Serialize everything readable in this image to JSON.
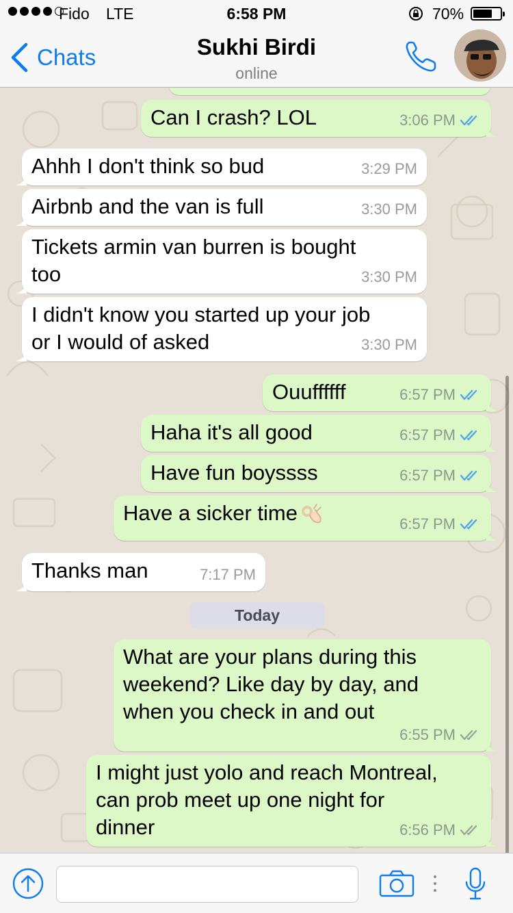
{
  "status_bar": {
    "carrier": "Fido",
    "network": "LTE",
    "time": "6:58 PM",
    "battery_percent": "70%",
    "battery_level": 0.7
  },
  "header": {
    "back_label": "Chats",
    "contact_name": "Sukhi Birdi",
    "status": "online"
  },
  "messages": [
    {
      "dir": "out",
      "text": "Can I crash? LOL",
      "time": "3:06 PM",
      "read": true
    },
    {
      "dir": "in",
      "text": "Ahhh I don't think so bud",
      "time": "3:29 PM"
    },
    {
      "dir": "in",
      "text": "Airbnb and the van is full",
      "time": "3:30 PM"
    },
    {
      "dir": "in",
      "text": "Tickets armin van burren is bought\ntoo",
      "time": "3:30 PM"
    },
    {
      "dir": "in",
      "text": "I didn't know you started up your job\nor I would of asked",
      "time": "3:30 PM"
    },
    {
      "dir": "out",
      "text": "Ouuffffff",
      "time": "6:57 PM",
      "read": true
    },
    {
      "dir": "out",
      "text": "Haha it's all good",
      "time": "6:57 PM",
      "read": true
    },
    {
      "dir": "out",
      "text": "Have fun boyssss",
      "time": "6:57 PM",
      "read": true
    },
    {
      "dir": "out",
      "text": "Have a sicker time",
      "time": "6:57 PM",
      "read": true,
      "emoji": "ok-hand-emoji"
    },
    {
      "dir": "in",
      "text": "Thanks man",
      "time": "7:17 PM"
    },
    {
      "dir": "out",
      "text": "What are your plans during this\nweekend? Like day by day, and\nwhen you check in and out",
      "time": "6:55 PM",
      "read": false
    },
    {
      "dir": "out",
      "text": "I might just yolo and reach Montreal,\ncan prob meet up one night for\ndinner",
      "time": "6:56 PM",
      "read": false
    }
  ],
  "day_separator": "Today",
  "input": {
    "placeholder": "",
    "value": ""
  },
  "colors": {
    "accent": "#0d7cf1",
    "outgoing_bubble": "#dcf8c6",
    "incoming_bubble": "#ffffff",
    "read_tick": "#4fa5e8",
    "delivered_tick": "#9aa59a"
  }
}
